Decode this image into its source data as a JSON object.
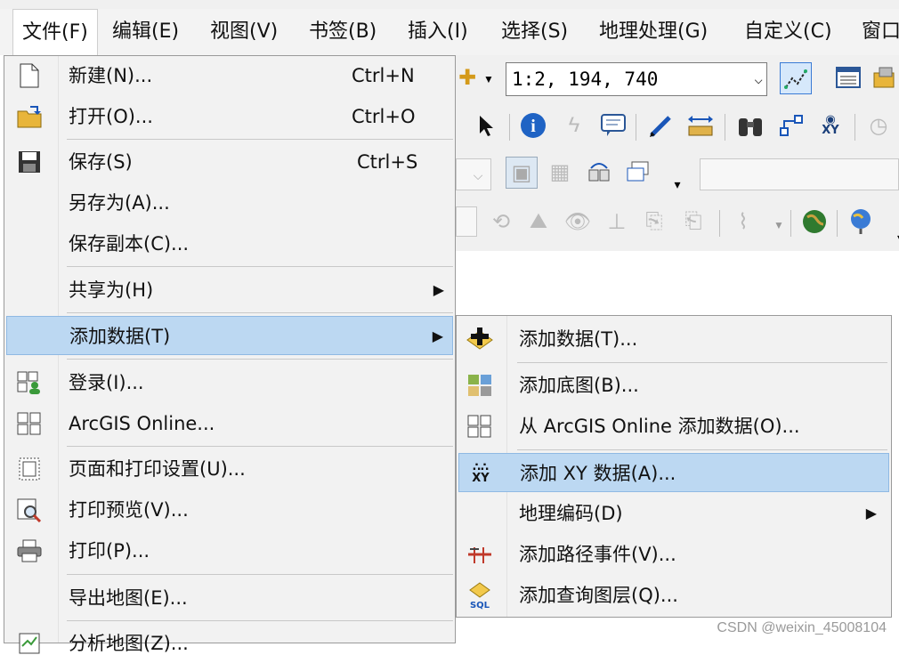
{
  "menubar": {
    "items": [
      {
        "label": "文件(F)"
      },
      {
        "label": "编辑(E)"
      },
      {
        "label": "视图(V)"
      },
      {
        "label": "书签(B)"
      },
      {
        "label": "插入(I)"
      },
      {
        "label": "选择(S)"
      },
      {
        "label": "地理处理(G)"
      },
      {
        "label": "自定义(C)"
      },
      {
        "label": "窗口"
      }
    ]
  },
  "toolbar": {
    "scale_value": "1:2, 194, 740"
  },
  "file_menu": {
    "items": [
      {
        "label": "新建(N)...",
        "shortcut": "Ctrl+N",
        "icon": "new-document-icon"
      },
      {
        "label": "打开(O)...",
        "shortcut": "Ctrl+O",
        "icon": "open-folder-icon"
      },
      {
        "label": "保存(S)",
        "shortcut": "Ctrl+S",
        "icon": "save-disk-icon"
      },
      {
        "label": "另存为(A)...",
        "shortcut": ""
      },
      {
        "label": "保存副本(C)...",
        "shortcut": ""
      },
      {
        "label": "共享为(H)",
        "shortcut": "",
        "submenu": true
      },
      {
        "label": "添加数据(T)",
        "shortcut": "",
        "submenu": true,
        "highlighted": true
      },
      {
        "label": "登录(I)...",
        "shortcut": "",
        "icon": "sign-in-icon"
      },
      {
        "label": "ArcGIS Online...",
        "shortcut": "",
        "icon": "arcgis-online-grid-icon"
      },
      {
        "label": "页面和打印设置(U)...",
        "shortcut": "",
        "icon": "page-setup-icon"
      },
      {
        "label": "打印预览(V)...",
        "shortcut": "",
        "icon": "print-preview-icon"
      },
      {
        "label": "打印(P)...",
        "shortcut": "",
        "icon": "printer-icon"
      },
      {
        "label": "导出地图(E)...",
        "shortcut": ""
      },
      {
        "label": "分析地图(Z)...",
        "shortcut": "",
        "icon": "analyze-map-icon"
      }
    ]
  },
  "add_data_submenu": {
    "items": [
      {
        "label": "添加数据(T)...",
        "icon": "add-data-plus-icon"
      },
      {
        "label": "添加底图(B)...",
        "icon": "add-basemap-icon"
      },
      {
        "label": "从 ArcGIS Online 添加数据(O)...",
        "icon": "arcgis-online-grid-icon"
      },
      {
        "label": "添加 XY 数据(A)...",
        "icon": "add-xy-data-icon",
        "highlighted": true
      },
      {
        "label": "地理编码(D)",
        "submenu": true
      },
      {
        "label": "添加路径事件(V)...",
        "icon": "route-events-icon"
      },
      {
        "label": "添加查询图层(Q)...",
        "icon": "sql-query-layer-icon"
      }
    ]
  },
  "watermark": "CSDN @weixin_45008104",
  "colors": {
    "highlight": "#bcd8f2",
    "menu_bg": "#f2f2f2"
  }
}
